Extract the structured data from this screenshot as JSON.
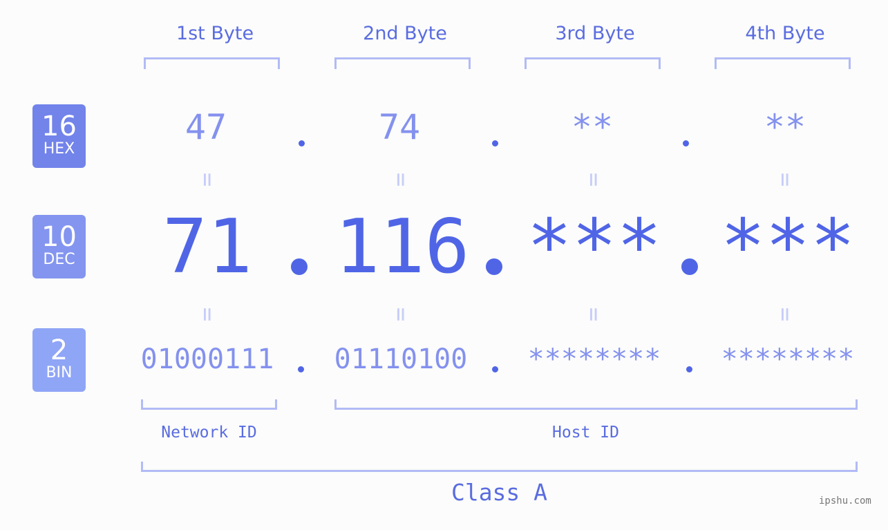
{
  "bytes": [
    {
      "header": "1st Byte",
      "hex": "47",
      "dec": "71",
      "bin": "01000111"
    },
    {
      "header": "2nd Byte",
      "hex": "74",
      "dec": "116",
      "bin": "01110100"
    },
    {
      "header": "3rd Byte",
      "hex": "**",
      "dec": "***",
      "bin": "********"
    },
    {
      "header": "4th Byte",
      "hex": "**",
      "dec": "***",
      "bin": "********"
    }
  ],
  "badges": {
    "hex": {
      "num": "16",
      "label": "HEX",
      "color": "#7283ea"
    },
    "dec": {
      "num": "10",
      "label": "DEC",
      "color": "#8495f0"
    },
    "bin": {
      "num": "2",
      "label": "BIN",
      "color": "#8fa5f6"
    }
  },
  "equals": "=",
  "network_label": "Network ID",
  "host_label": "Host ID",
  "class_label": "Class A",
  "watermark": "ipshu.com"
}
